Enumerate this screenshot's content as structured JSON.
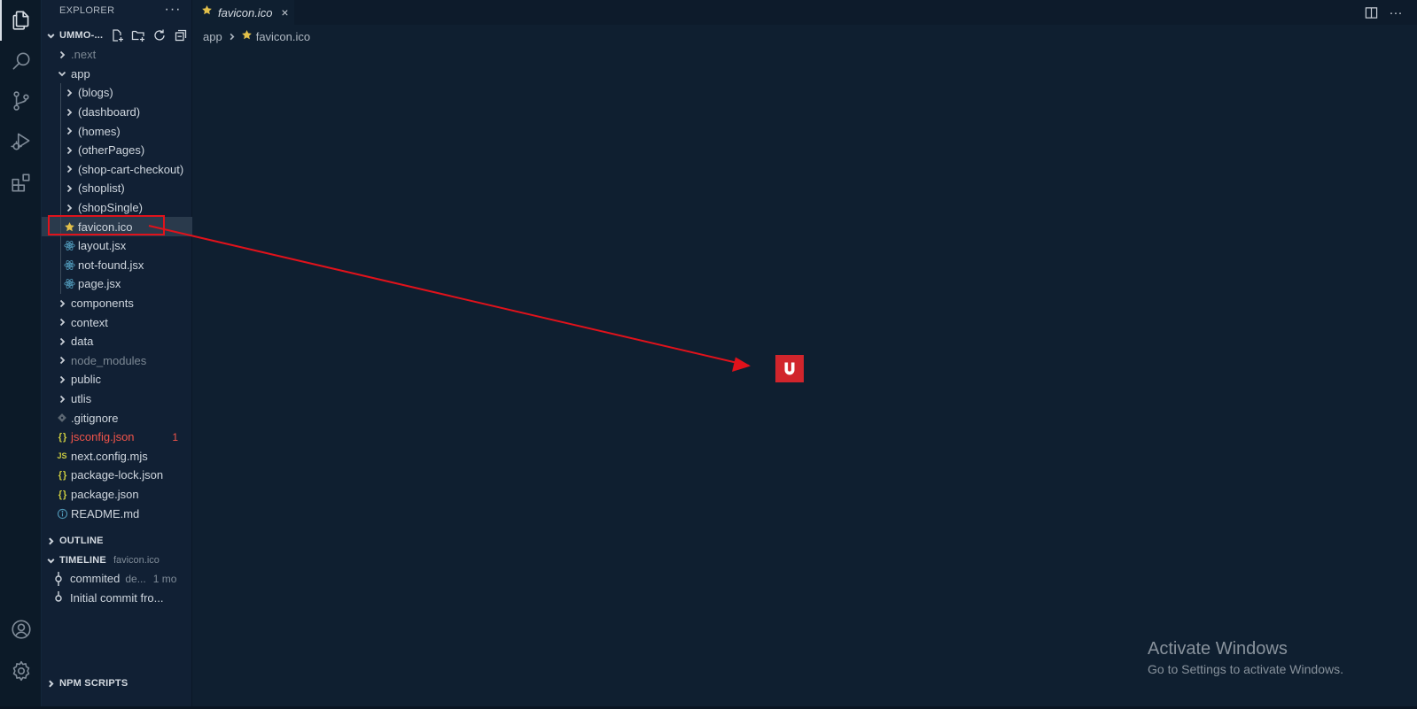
{
  "explorer": {
    "title": "EXPLORER",
    "project_name": "UMMO-...",
    "tree": [
      {
        "label": ".next",
        "kind": "folder",
        "depth": 1,
        "dim": true
      },
      {
        "label": "app",
        "kind": "folder-open",
        "depth": 1
      },
      {
        "label": "(blogs)",
        "kind": "folder",
        "depth": 2
      },
      {
        "label": "(dashboard)",
        "kind": "folder",
        "depth": 2
      },
      {
        "label": "(homes)",
        "kind": "folder",
        "depth": 2
      },
      {
        "label": "(otherPages)",
        "kind": "folder",
        "depth": 2
      },
      {
        "label": "(shop-cart-checkout)",
        "kind": "folder",
        "depth": 2
      },
      {
        "label": "(shoplist)",
        "kind": "folder",
        "depth": 2
      },
      {
        "label": "(shopSingle)",
        "kind": "folder",
        "depth": 2
      },
      {
        "label": "favicon.ico",
        "kind": "file",
        "icon": "star-icon",
        "depth": 2,
        "selected": true
      },
      {
        "label": "layout.jsx",
        "kind": "file",
        "icon": "react-icon",
        "depth": 2
      },
      {
        "label": "not-found.jsx",
        "kind": "file",
        "icon": "react-icon",
        "depth": 2
      },
      {
        "label": "page.jsx",
        "kind": "file",
        "icon": "react-icon",
        "depth": 2
      },
      {
        "label": "components",
        "kind": "folder",
        "depth": 1
      },
      {
        "label": "context",
        "kind": "folder",
        "depth": 1
      },
      {
        "label": "data",
        "kind": "folder",
        "depth": 1
      },
      {
        "label": "node_modules",
        "kind": "folder",
        "depth": 1,
        "dim": true
      },
      {
        "label": "public",
        "kind": "folder",
        "depth": 1
      },
      {
        "label": "utlis",
        "kind": "folder",
        "depth": 1
      },
      {
        "label": ".gitignore",
        "kind": "file",
        "icon": "git-icon",
        "depth": 1
      },
      {
        "label": "jsconfig.json",
        "kind": "file",
        "icon": "json-icon",
        "depth": 1,
        "error": true,
        "badge": "1"
      },
      {
        "label": "next.config.mjs",
        "kind": "file",
        "icon": "js-icon",
        "depth": 1
      },
      {
        "label": "package-lock.json",
        "kind": "file",
        "icon": "json-icon",
        "depth": 1
      },
      {
        "label": "package.json",
        "kind": "file",
        "icon": "json-icon",
        "depth": 1
      },
      {
        "label": "README.md",
        "kind": "file",
        "icon": "info-icon",
        "depth": 1
      }
    ]
  },
  "outline": {
    "label": "OUTLINE"
  },
  "timeline": {
    "label": "TIMELINE",
    "file": "favicon.ico",
    "entries": [
      {
        "message": "commited",
        "author": "de...",
        "age": "1 mo"
      },
      {
        "message": "Initial commit fro...",
        "author": "",
        "age": ""
      }
    ]
  },
  "npm_scripts": {
    "label": "NPM SCRIPTS"
  },
  "editor": {
    "tab_title": "favicon.ico",
    "tab_close": "×",
    "breadcrumb": [
      "app",
      "favicon.ico"
    ],
    "preview_letter": "U"
  },
  "watermark": {
    "title": "Activate Windows",
    "subtitle": "Go to Settings to activate Windows."
  },
  "colors": {
    "annotation": "#e0121b",
    "favicon_bg": "#d1252c",
    "star": "#e2c04a",
    "react": "#519aba",
    "json": "#cbcb41",
    "error": "#f1544a"
  }
}
